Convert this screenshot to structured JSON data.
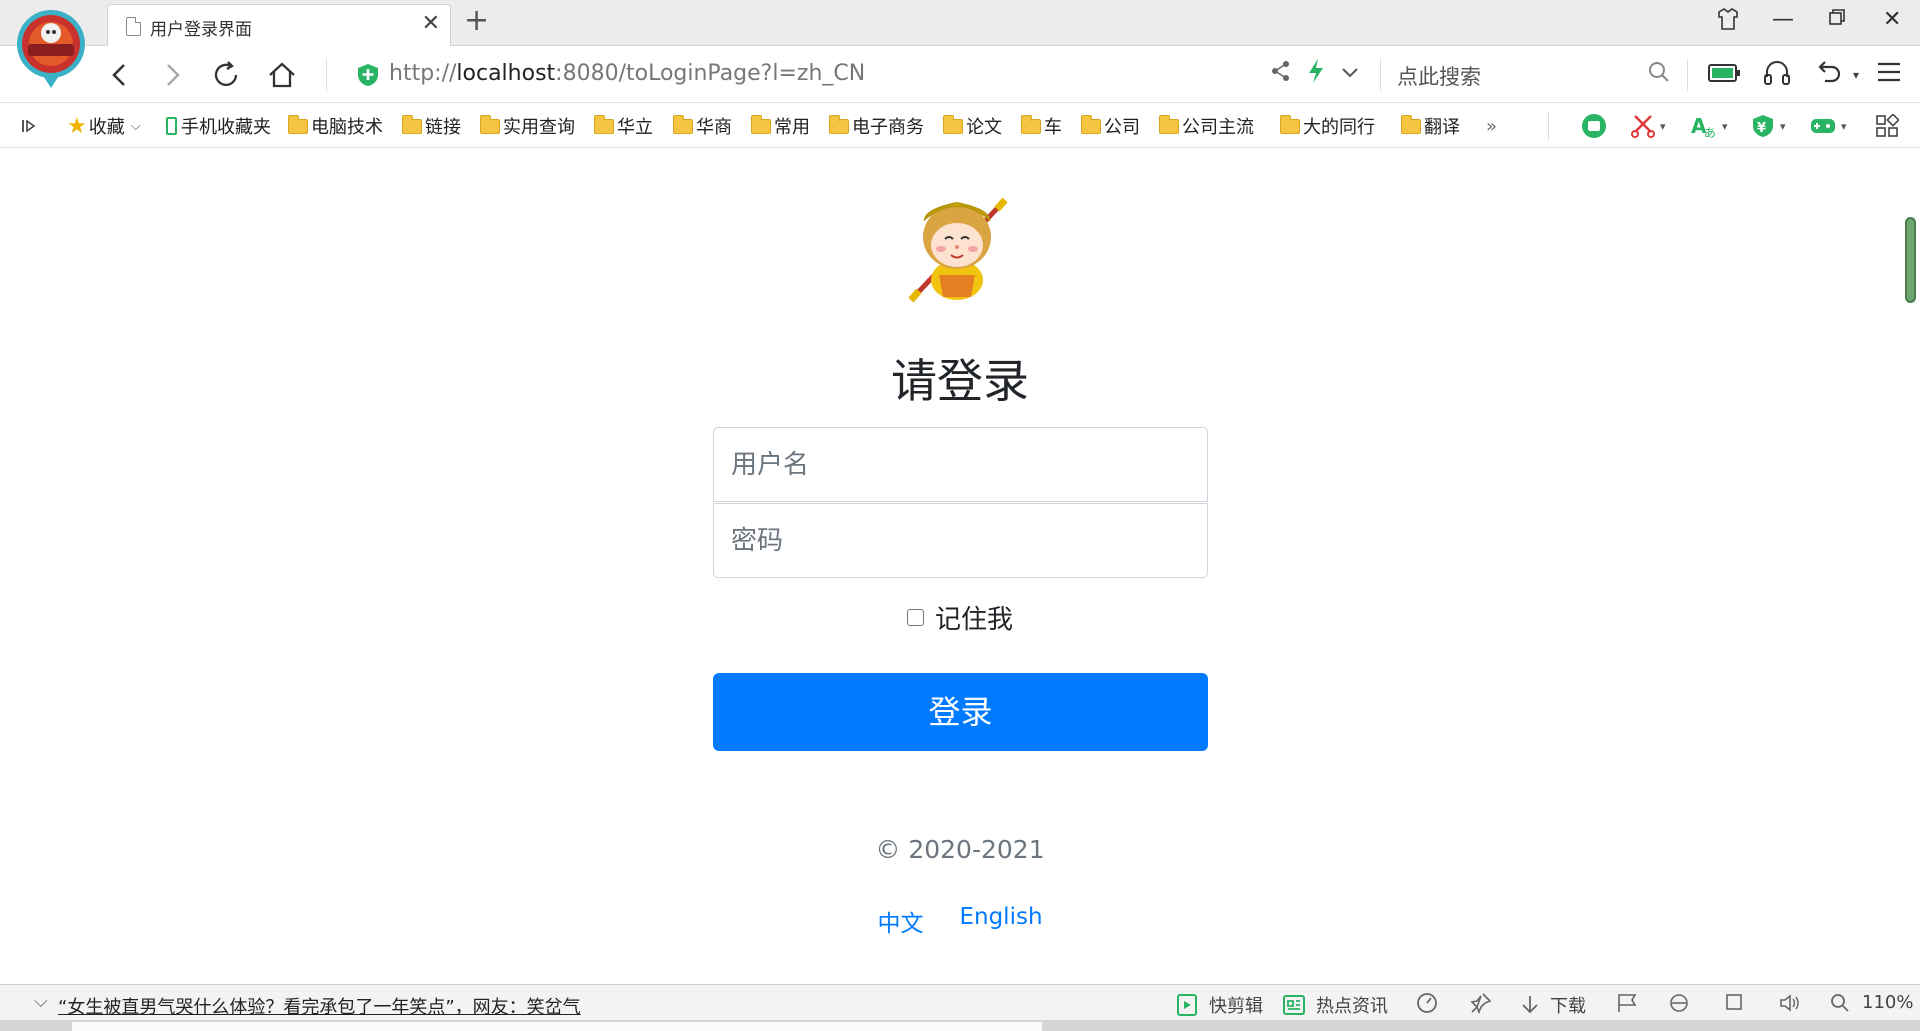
{
  "browser": {
    "tab_title": "用户登录界面",
    "url_prefix": "http://",
    "url_host": "localhost",
    "url_rest": ":8080/toLoginPage?l=zh_CN",
    "search_placeholder": "点此搜索",
    "bookmarks": [
      "收藏",
      "手机收藏夹",
      "电脑技术",
      "链接",
      "实用查询",
      "华立",
      "华商",
      "常用",
      "电子商务",
      "论文",
      "车",
      "公司",
      "公司主流",
      "大的同行",
      "翻译"
    ]
  },
  "login": {
    "heading": "请登录",
    "username_placeholder": "用户名",
    "password_placeholder": "密码",
    "remember_label": "记住我",
    "submit_label": "登录",
    "copyright": "© 2020-2021",
    "lang_zh": "中文",
    "lang_en": "English"
  },
  "statusbar": {
    "news": "“女生被直男气哭什么体验？看完承包了一年笑点”，网友：笑岔气",
    "quick_edit": "快剪辑",
    "hot_news": "热点资讯",
    "download": "下载",
    "zoom": "110%"
  },
  "colors": {
    "primary": "#007bff",
    "muted": "#6c757d"
  }
}
